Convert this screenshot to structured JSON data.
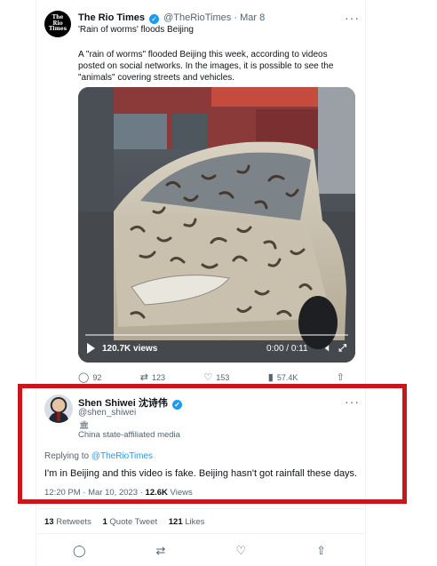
{
  "tweet1": {
    "logo_text": "The\nRio\nTimes",
    "name": "The Rio Times",
    "handle": "@TheRioTimes",
    "separator": "·",
    "date": "Mar 8",
    "subtitle": "'Rain of worms' floods Beijing",
    "body": "A \"rain of worms\" flooded Beijing this week, according to videos posted on social networks. In the images, it is possible to see the \"animals\" covering streets and vehicles.",
    "video": {
      "views": "120.7K views",
      "time": "0:00 / 0:11",
      "progress": 0.0
    },
    "actions": {
      "replies": "92",
      "retweets": "123",
      "likes": "153",
      "views": "57.4K"
    }
  },
  "tweet2": {
    "name": "Shen Shiwei 沈诗伟",
    "handle": "@shen_shiwei",
    "badge_label": "China state-affiliated media",
    "replying_prefix": "Replying to",
    "replying_to": "@TheRioTimes",
    "text": "I'm in Beijing and this video is fake. Beijing hasn't got rainfall these days.",
    "timestamp": "12:20 PM · Mar 10, 2023",
    "separator": "·",
    "views_count": "12.6K",
    "views_label": "Views"
  },
  "stats": {
    "retweets_count": "13",
    "retweets_label": "Retweets",
    "quotes_count": "1",
    "quotes_label": "Quote Tweet",
    "likes_count": "121",
    "likes_label": "Likes"
  },
  "colors": {
    "accent": "#1d9bf0",
    "highlight_box": "#c8161c",
    "muted_text": "#536471"
  },
  "icons": {
    "more": "more-dots-icon",
    "verified": "verified-badge-icon",
    "reply": "reply-icon",
    "retweet": "retweet-icon",
    "like": "heart-icon",
    "views": "bar-chart-icon",
    "share": "share-icon"
  }
}
